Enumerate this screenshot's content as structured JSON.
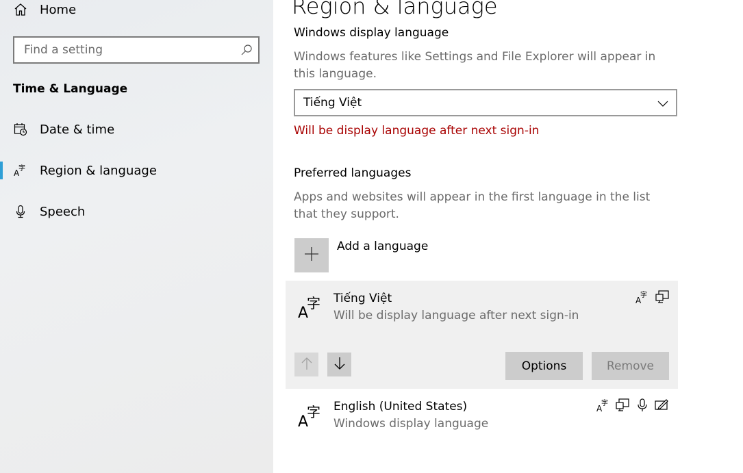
{
  "sidebar": {
    "home_label": "Home",
    "search_placeholder": "Find a setting",
    "section_title": "Time & Language",
    "items": [
      {
        "label": "Date & time",
        "icon": "calendar-clock-icon"
      },
      {
        "label": "Region & language",
        "icon": "language-icon",
        "active": true
      },
      {
        "label": "Speech",
        "icon": "microphone-icon"
      }
    ]
  },
  "main": {
    "title": "Region & language",
    "display_language": {
      "heading": "Windows display language",
      "description": "Windows features like Settings and File Explorer will appear in this language.",
      "selected": "Tiếng Việt",
      "warning": "Will be display language after next sign-in"
    },
    "preferred": {
      "heading": "Preferred languages",
      "description": "Apps and websites will appear in the first language in the list that they support.",
      "add_label": "Add a language",
      "languages": [
        {
          "name": "Tiếng Việt",
          "status": "Will be display language after next sign-in",
          "features": [
            "language-pack-icon",
            "display-icon"
          ]
        },
        {
          "name": "English (United States)",
          "status": "Windows display language",
          "features": [
            "language-pack-icon",
            "display-icon",
            "microphone-icon",
            "handwriting-icon"
          ]
        }
      ],
      "options_label": "Options",
      "remove_label": "Remove"
    }
  },
  "colors": {
    "accent": "#2f9fd6",
    "warning": "#a80000",
    "button_bg": "#cccccc"
  }
}
